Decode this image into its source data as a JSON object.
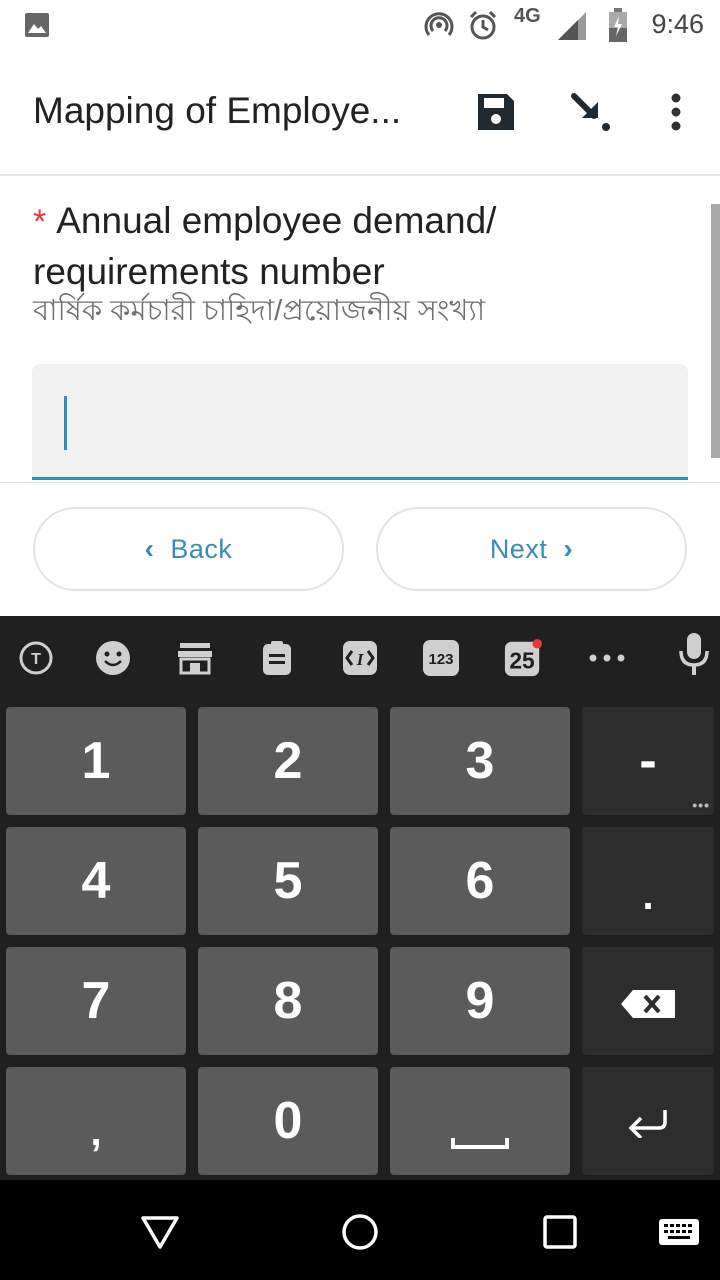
{
  "status_bar": {
    "network": "4G",
    "time": "9:46"
  },
  "app_bar": {
    "title": "Mapping of Employe...",
    "icons": [
      "save-icon",
      "download-icon",
      "more-vert-icon"
    ]
  },
  "question": {
    "required_marker": "*",
    "title": "Annual employee demand/ requirements number",
    "subtitle": "বার্ষিক কর্মচারী চাহিদা/প্রয়োজনীয় সংখ্যা",
    "input_value": ""
  },
  "navigation": {
    "back_label": "Back",
    "next_label": "Next"
  },
  "keyboard": {
    "toolbar": {
      "number_badge": "123",
      "date_badge": "25"
    },
    "keys": {
      "k1": "1",
      "k2": "2",
      "k3": "3",
      "dash": "-",
      "k4": "4",
      "k5": "5",
      "k6": "6",
      "dot": ".",
      "k7": "7",
      "k8": "8",
      "k9": "9",
      "comma": ",",
      "k0": "0"
    }
  },
  "colors": {
    "accent": "#3a8bb5",
    "required": "#e53935",
    "keyboard_bg": "#202020",
    "key_bg": "#5b5b5b"
  }
}
